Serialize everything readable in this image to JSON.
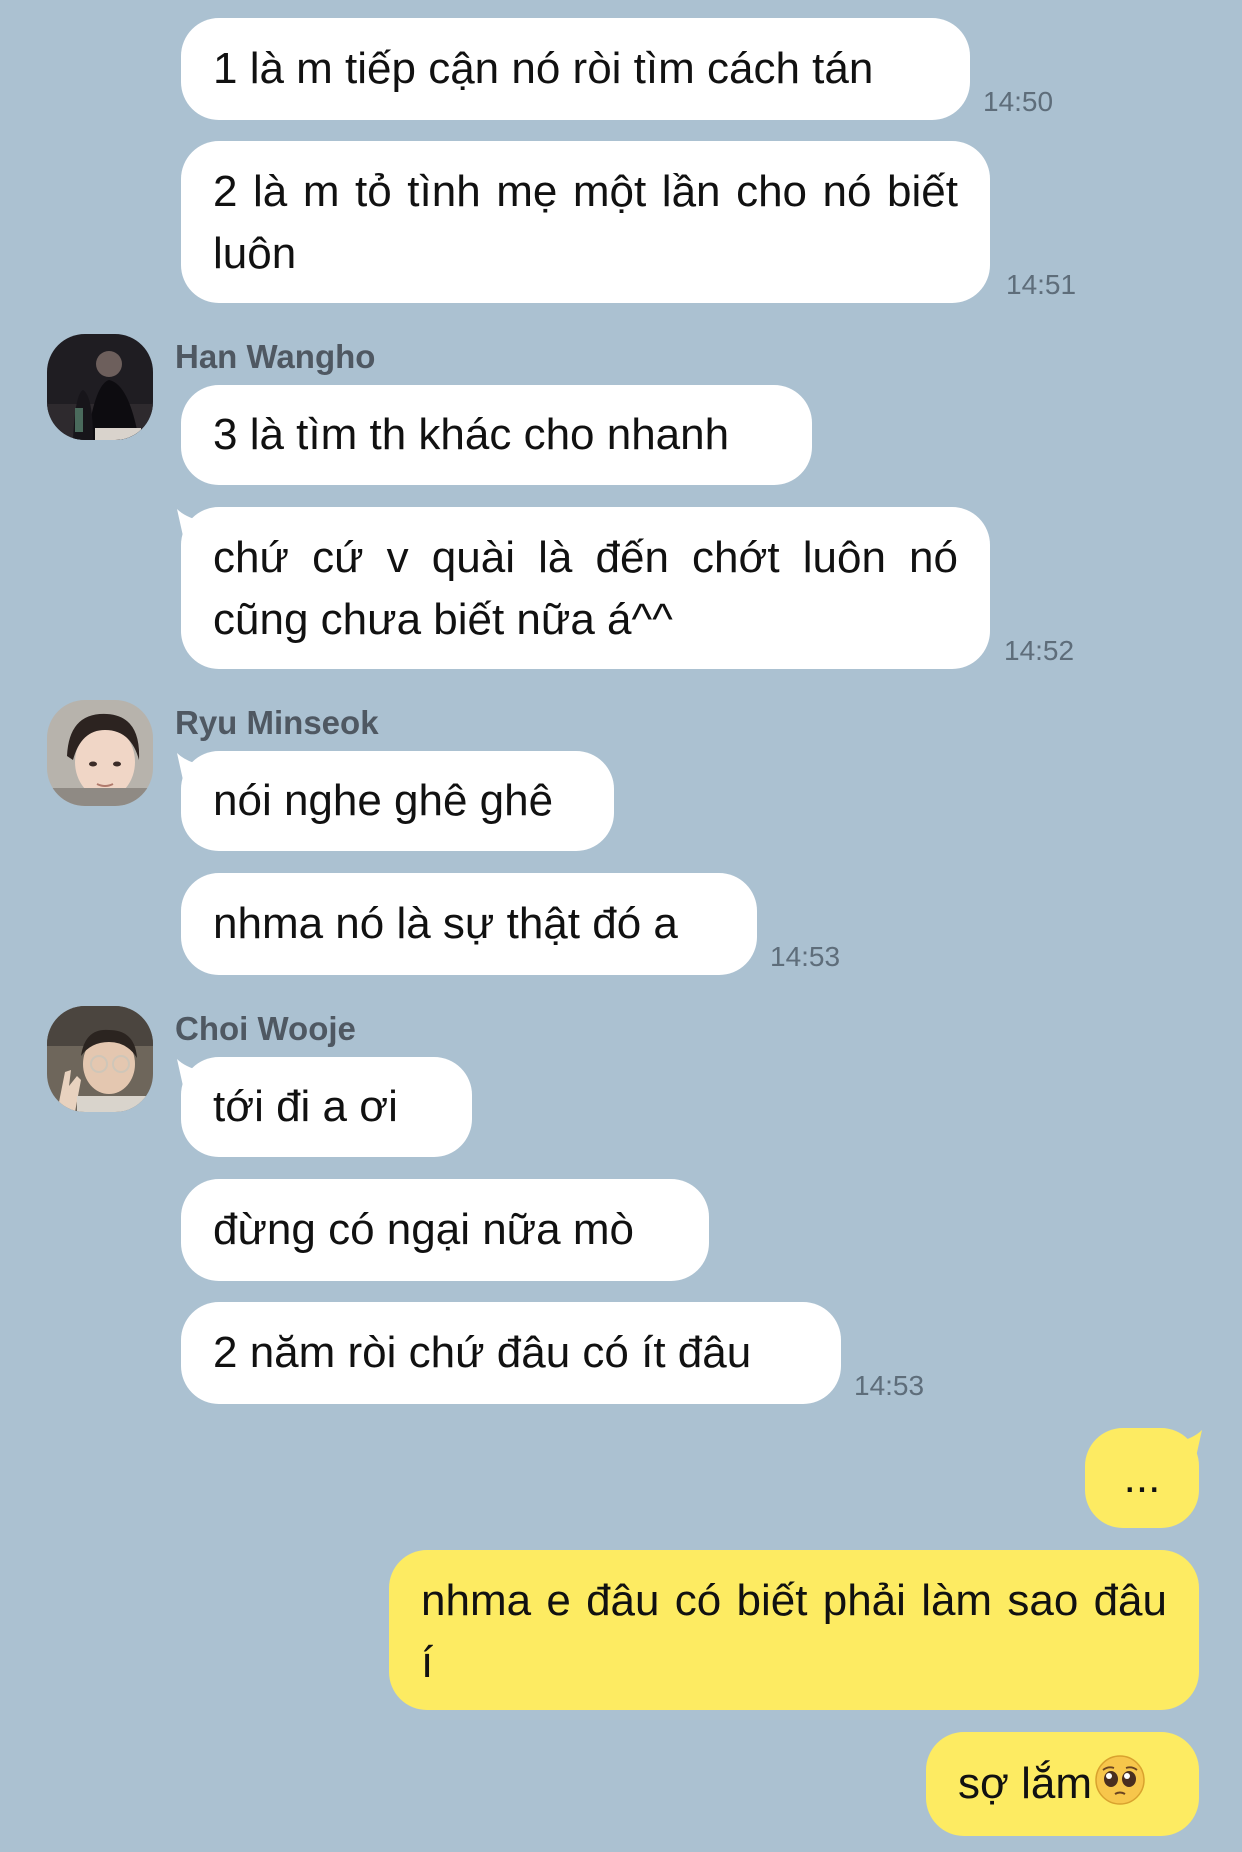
{
  "messages": {
    "m1": {
      "text": "1 là m tiếp cận nó ròi tìm cách tán",
      "time": "14:50"
    },
    "m2": {
      "text": "2 là m tỏ tình mẹ một lần cho nó biết luôn",
      "time": "14:51"
    },
    "han": {
      "name": "Han Wangho"
    },
    "m3": {
      "text": "3 là tìm th khác cho nhanh"
    },
    "m4": {
      "text": "chứ cứ v quài là đến chớt luôn nó cũng chưa biết nữa á^^",
      "time": "14:52"
    },
    "ryu": {
      "name": "Ryu Minseok"
    },
    "m5": {
      "text": "nói nghe ghê ghê"
    },
    "m6": {
      "text": "nhma nó là sự thật đó a",
      "time": "14:53"
    },
    "choi": {
      "name": "Choi Wooje"
    },
    "m7": {
      "text": "tới đi a ơi"
    },
    "m8": {
      "text": "đừng có ngại nữa mò"
    },
    "m9": {
      "text": "2 năm ròi chứ đâu có ít đâu",
      "time": "14:53"
    },
    "o1": {
      "text": "..."
    },
    "o2": {
      "text": "nhma e đâu có biết phải làm sao đâu í"
    },
    "o3": {
      "text": "sợ lắm"
    }
  },
  "colors": {
    "background": "#abc1d1",
    "incoming_bubble": "#ffffff",
    "outgoing_bubble": "#fdeb62",
    "timestamp": "#5e6d7a",
    "sender_name": "#4f5862"
  },
  "icons": {
    "o3_emoji": "pleading-face-emoji"
  }
}
